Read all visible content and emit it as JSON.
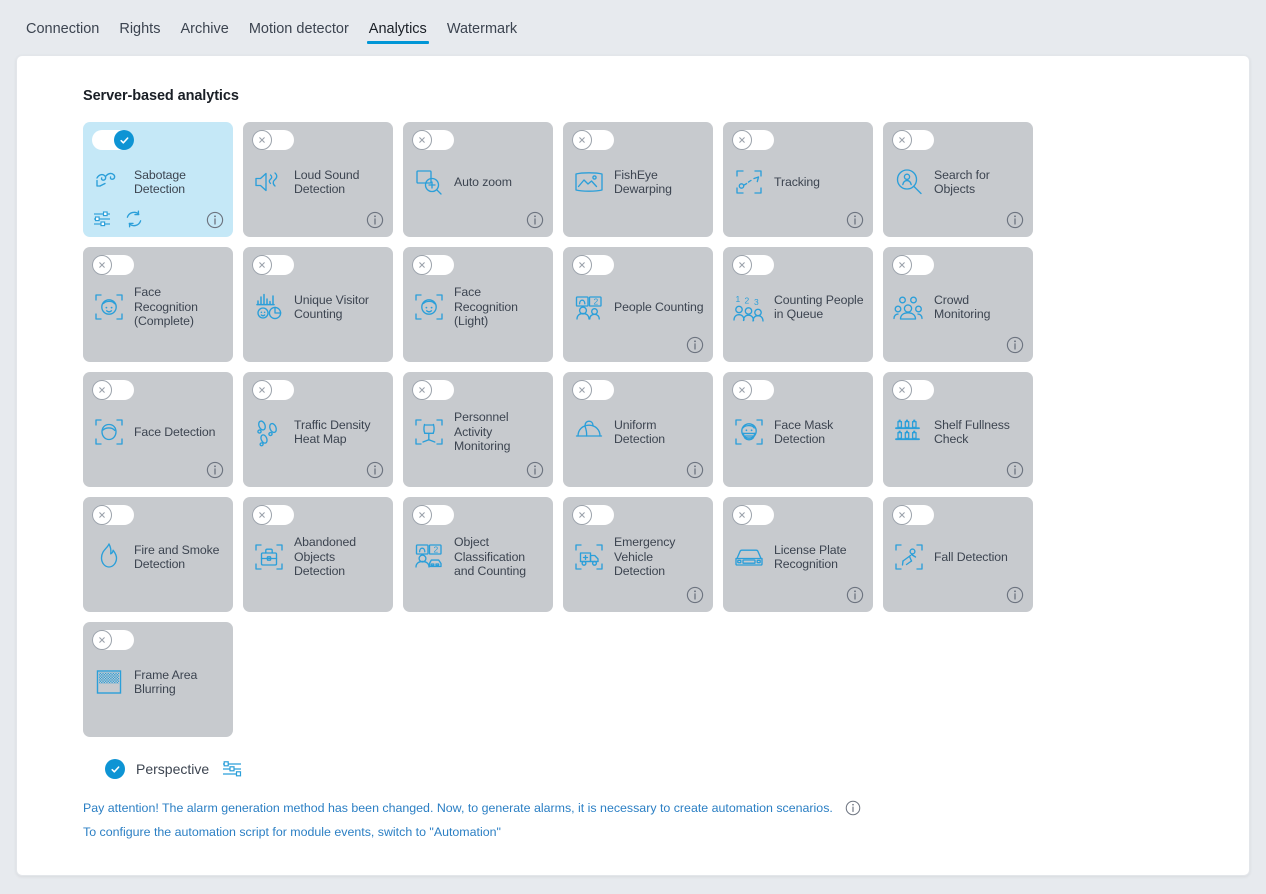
{
  "tabs": [
    {
      "label": "Connection",
      "active": false
    },
    {
      "label": "Rights",
      "active": false
    },
    {
      "label": "Archive",
      "active": false
    },
    {
      "label": "Motion detector",
      "active": false
    },
    {
      "label": "Analytics",
      "active": true
    },
    {
      "label": "Watermark",
      "active": false
    }
  ],
  "section": {
    "title": "Server-based analytics"
  },
  "colors": {
    "accent": "#0e94d4",
    "tab_underline": "#0096d6",
    "card_off_bg": "#c7cace",
    "card_on_bg": "#c5e8f7",
    "icon_blue": "#2b9fd9",
    "text": "#3c4450",
    "link": "#2b7fc4",
    "page_bg": "#e7eaee",
    "panel_bg": "#ffffff"
  },
  "cards": [
    {
      "label": "Sabotage Detection",
      "icon": "sabotage-detection-icon",
      "enabled": true,
      "info": true,
      "actions": [
        "settings-sliders-icon",
        "sync-refresh-icon"
      ]
    },
    {
      "label": "Loud Sound Detection",
      "icon": "loud-sound-icon",
      "enabled": false,
      "info": true,
      "actions": []
    },
    {
      "label": "Auto zoom",
      "icon": "auto-zoom-icon",
      "enabled": false,
      "info": true,
      "actions": []
    },
    {
      "label": "FishEye Dewarping",
      "icon": "fisheye-dewarping-icon",
      "enabled": false,
      "info": false,
      "actions": []
    },
    {
      "label": "Tracking",
      "icon": "tracking-icon",
      "enabled": false,
      "info": true,
      "actions": []
    },
    {
      "label": "Search for Objects",
      "icon": "search-objects-icon",
      "enabled": false,
      "info": true,
      "actions": []
    },
    {
      "label": "Face Recognition (Complete)",
      "icon": "face-recognition-icon",
      "enabled": false,
      "info": false,
      "actions": []
    },
    {
      "label": "Unique Visitor Counting",
      "icon": "unique-visitor-counting-icon",
      "enabled": false,
      "info": false,
      "actions": []
    },
    {
      "label": "Face Recognition (Light)",
      "icon": "face-recognition-icon",
      "enabled": false,
      "info": false,
      "actions": []
    },
    {
      "label": "People Counting",
      "icon": "people-counting-icon",
      "enabled": false,
      "info": true,
      "actions": []
    },
    {
      "label": "Counting People in Queue",
      "icon": "queue-counting-icon",
      "enabled": false,
      "info": false,
      "actions": []
    },
    {
      "label": "Crowd Monitoring",
      "icon": "crowd-monitoring-icon",
      "enabled": false,
      "info": true,
      "actions": []
    },
    {
      "label": "Face Detection",
      "icon": "face-detection-icon",
      "enabled": false,
      "info": true,
      "actions": []
    },
    {
      "label": "Traffic Density Heat Map",
      "icon": "footprints-icon",
      "enabled": false,
      "info": true,
      "actions": []
    },
    {
      "label": "Personnel Activity Monitoring",
      "icon": "chair-activity-icon",
      "enabled": false,
      "info": true,
      "actions": []
    },
    {
      "label": "Uniform Detection",
      "icon": "helmet-icon",
      "enabled": false,
      "info": true,
      "actions": []
    },
    {
      "label": "Face Mask Detection",
      "icon": "face-mask-icon",
      "enabled": false,
      "info": false,
      "actions": []
    },
    {
      "label": "Shelf Fullness Check",
      "icon": "shelf-icon",
      "enabled": false,
      "info": true,
      "actions": []
    },
    {
      "label": "Fire and Smoke Detection",
      "icon": "flame-icon",
      "enabled": false,
      "info": false,
      "actions": []
    },
    {
      "label": "Abandoned Objects Detection",
      "icon": "abandoned-bag-icon",
      "enabled": false,
      "info": false,
      "actions": []
    },
    {
      "label": "Object Classification and Counting",
      "icon": "object-classification-icon",
      "enabled": false,
      "info": false,
      "actions": []
    },
    {
      "label": "Emergency Vehicle Detection",
      "icon": "ambulance-icon",
      "enabled": false,
      "info": true,
      "actions": []
    },
    {
      "label": "License Plate Recognition",
      "icon": "car-plate-icon",
      "enabled": false,
      "info": true,
      "actions": []
    },
    {
      "label": "Fall Detection",
      "icon": "fall-detection-icon",
      "enabled": false,
      "info": true,
      "actions": []
    },
    {
      "label": "Frame Area Blurring",
      "icon": "frame-blur-icon",
      "enabled": false,
      "info": false,
      "actions": []
    }
  ],
  "perspective": {
    "label": "Perspective",
    "enabled": true,
    "config_icon": "settings-sliders-icon"
  },
  "notes": [
    {
      "text": "Pay attention! The alarm generation method has been changed. Now, to generate alarms, it is necessary to create automation scenarios.",
      "info": true
    },
    {
      "text": "To configure the automation script for module events, switch to \"Automation\"",
      "info": false
    }
  ]
}
